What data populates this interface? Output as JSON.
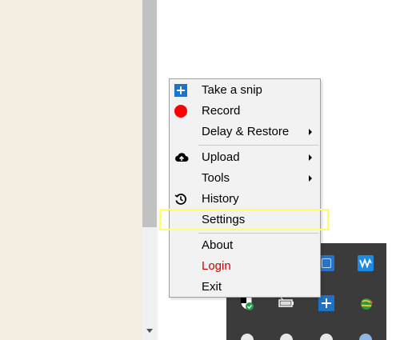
{
  "context_menu": {
    "items": [
      {
        "label": "Take a snip",
        "icon": "plus-square-icon"
      },
      {
        "label": "Record",
        "icon": "red-circle-icon"
      },
      {
        "label": "Delay & Restore",
        "submenu": true
      },
      {
        "label": "Upload",
        "icon": "cloud-upload-icon",
        "submenu": true
      },
      {
        "label": "Tools",
        "submenu": true
      },
      {
        "label": "History",
        "icon": "history-clock-icon"
      },
      {
        "label": "Settings",
        "highlighted": true
      },
      {
        "label": "About"
      },
      {
        "label": "Login",
        "color": "#d00000"
      },
      {
        "label": "Exit"
      }
    ]
  },
  "colors": {
    "left_pane": "#f4eee0",
    "tray_background": "#3b3b3b",
    "highlight_outline": "#ffff66",
    "login_text": "#d00000",
    "accent_blue": "#1e73c8"
  },
  "tray_icons": [
    "tools-icon",
    "audio-wave-icon",
    "shield-check-icon",
    "battery-icon",
    "snip-plus-icon",
    "globe-icon"
  ]
}
